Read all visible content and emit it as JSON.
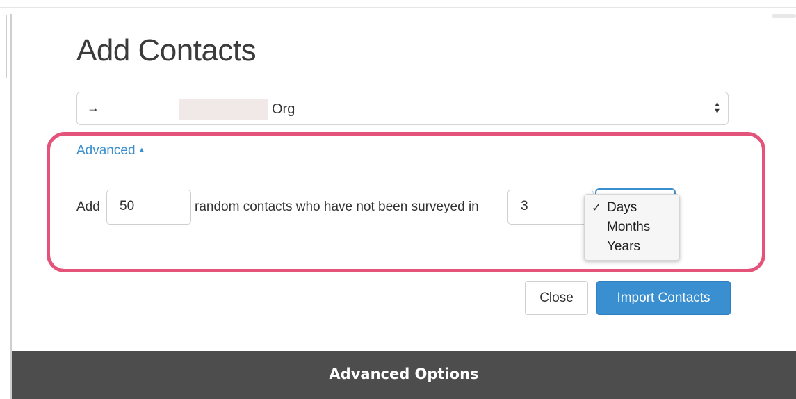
{
  "modal": {
    "title": "Add Contacts",
    "org_select": {
      "arrow": "→",
      "selected_suffix": "Org"
    },
    "advanced": {
      "toggle_label": "Advanced",
      "toggle_caret": "▲",
      "row": {
        "prefix": "Add",
        "count_value": "50",
        "middle_text": "random contacts who have not been surveyed in",
        "period_value": "3"
      },
      "unit_dropdown": {
        "selected": "Days",
        "options": [
          "Days",
          "Months",
          "Years"
        ],
        "check_mark": "✓"
      }
    },
    "buttons": {
      "close": "Close",
      "import": "Import Contacts"
    }
  },
  "caption": "Advanced Options",
  "colors": {
    "accent": "#3a8fd0",
    "highlight": "#e3537a",
    "caption_bar": "#4d4d4d"
  }
}
